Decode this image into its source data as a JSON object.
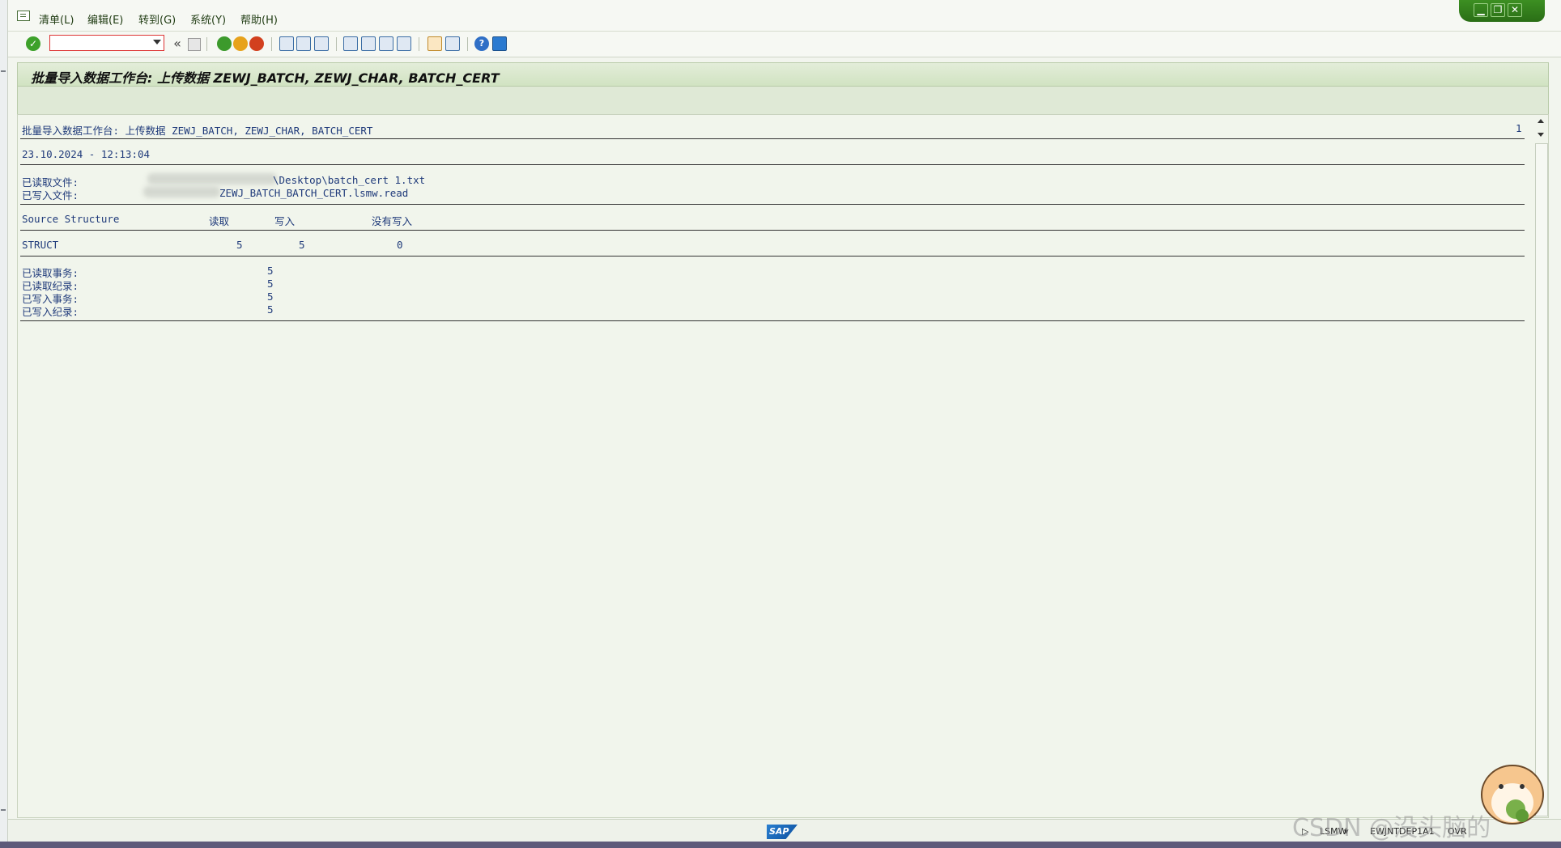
{
  "menu": {
    "items": [
      "清单(L)",
      "编辑(E)",
      "转到(G)",
      "系统(Y)",
      "帮助(H)"
    ]
  },
  "window_controls": {
    "minimize": "▁",
    "restore": "❐",
    "close": "✕"
  },
  "toolbar": {
    "command_field_value": "",
    "icons": [
      "enter-icon",
      "back-icon",
      "exit-icon",
      "cancel-icon",
      "print-icon",
      "find-icon",
      "find-next-icon",
      "first-page-icon",
      "previous-page-icon",
      "next-page-icon",
      "last-page-icon",
      "create-session-icon",
      "generate-shortcut-icon",
      "help-icon",
      "customize-layout-icon"
    ]
  },
  "title": "批量导入数据工作台: 上传数据 ZEWJ_BATCH, ZEWJ_CHAR, BATCH_CERT",
  "list": {
    "header": "批量导入数据工作台: 上传数据 ZEWJ_BATCH, ZEWJ_CHAR, BATCH_CERT",
    "page_number": "1",
    "datetime": "23.10.2024 - 12:13:04",
    "read_file_label": "已读取文件:",
    "read_file_value": "\\Desktop\\batch_cert 1.txt",
    "written_file_label": "已写入文件:",
    "written_file_value": "ZEWJ_BATCH_BATCH_CERT.lsmw.read",
    "table_headers": {
      "source_structure": "Source Structure",
      "read": "读取",
      "written": "写入",
      "not_written": "没有写入"
    },
    "table_rows": [
      {
        "structure": "STRUCT",
        "read": "5",
        "written": "5",
        "not_written": "0"
      }
    ],
    "summary": [
      {
        "label": "已读取事务:",
        "value": "5"
      },
      {
        "label": "已读取纪录:",
        "value": "5"
      },
      {
        "label": "已写入事务:",
        "value": "5"
      },
      {
        "label": "已写入纪录:",
        "value": "5"
      }
    ]
  },
  "status": {
    "sap_logo": "SAP",
    "transaction": "LSMW",
    "server": "EWJNTDEP1A1",
    "mode": "OVR"
  },
  "watermark": "CSDN @没头脑的"
}
